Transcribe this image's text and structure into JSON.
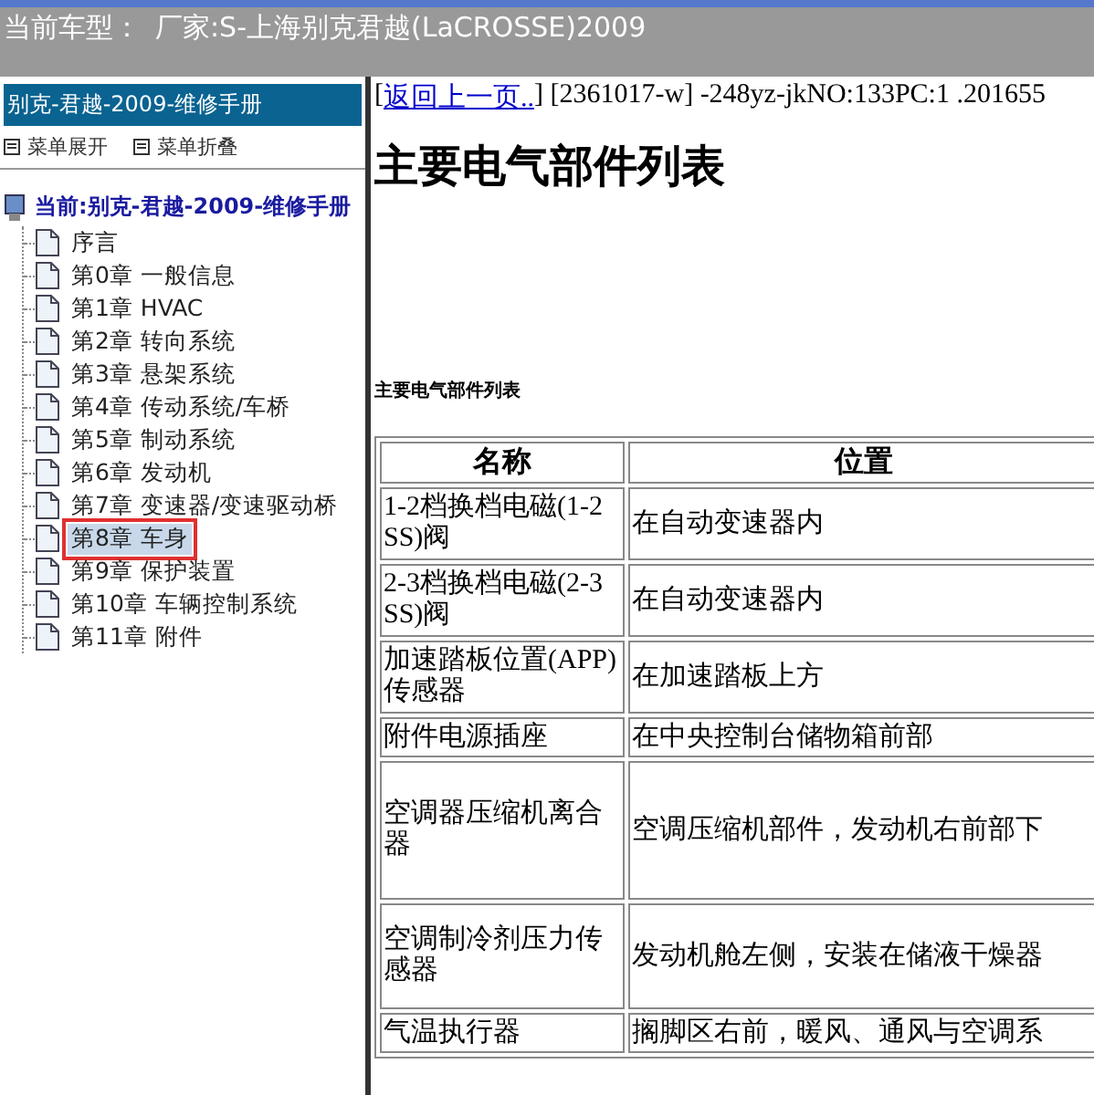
{
  "header": {
    "label": "当前车型：",
    "value": "厂家:S-上海别克君越(LaCROSSE)2009"
  },
  "sidebar": {
    "title": "别克-君越-2009-维修手册",
    "actions": [
      "菜单展开",
      "菜单折叠"
    ],
    "root": "当前:别克-君越-2009-维修手册",
    "items": [
      {
        "label": "序言",
        "selected": false
      },
      {
        "label": "第0章 一般信息",
        "selected": false
      },
      {
        "label": "第1章 HVAC",
        "selected": false
      },
      {
        "label": "第2章 转向系统",
        "selected": false
      },
      {
        "label": "第3章 悬架系统",
        "selected": false
      },
      {
        "label": "第4章 传动系统/车桥",
        "selected": false
      },
      {
        "label": "第5章 制动系统",
        "selected": false
      },
      {
        "label": "第6章 发动机",
        "selected": false
      },
      {
        "label": "第7章 变速器/变速驱动桥",
        "selected": false
      },
      {
        "label": "第8章 车身",
        "selected": true
      },
      {
        "label": "第9章 保护装置",
        "selected": false
      },
      {
        "label": "第10章 车辆控制系统",
        "selected": false
      },
      {
        "label": "第11章 附件",
        "selected": false
      }
    ]
  },
  "content": {
    "lead": "[",
    "back_link": "返回上一页..",
    "info": "] [2361017-w] -248yz-jkNO:133PC:1 .201655",
    "title": "主要电气部件列表",
    "subtitle": "主要电气部件列表",
    "table": {
      "columns": [
        "名称",
        "位置"
      ],
      "rows": [
        {
          "cells": [
            "1-2档换档电磁(1-2 SS)阀",
            "在自动变速器内"
          ]
        },
        {
          "cells": [
            "2-3档换档电磁(2-3 SS)阀",
            "在自动变速器内"
          ]
        },
        {
          "cells": [
            "加速踏板位置(APP)传感器",
            "在加速踏板上方"
          ]
        },
        {
          "cells": [
            "附件电源插座",
            "在中央控制台储物箱前部"
          ]
        },
        {
          "cells": [
            "空调器压缩机离合器",
            "空调压缩机部件，发动机右前部下"
          ]
        },
        {
          "cells": [
            "空调制冷剂压力传感器",
            "发动机舱左侧，安装在储液干燥器"
          ]
        },
        {
          "cells": [
            "气温执行器",
            "搁脚区右前，暖风、通风与空调系"
          ]
        }
      ]
    }
  }
}
